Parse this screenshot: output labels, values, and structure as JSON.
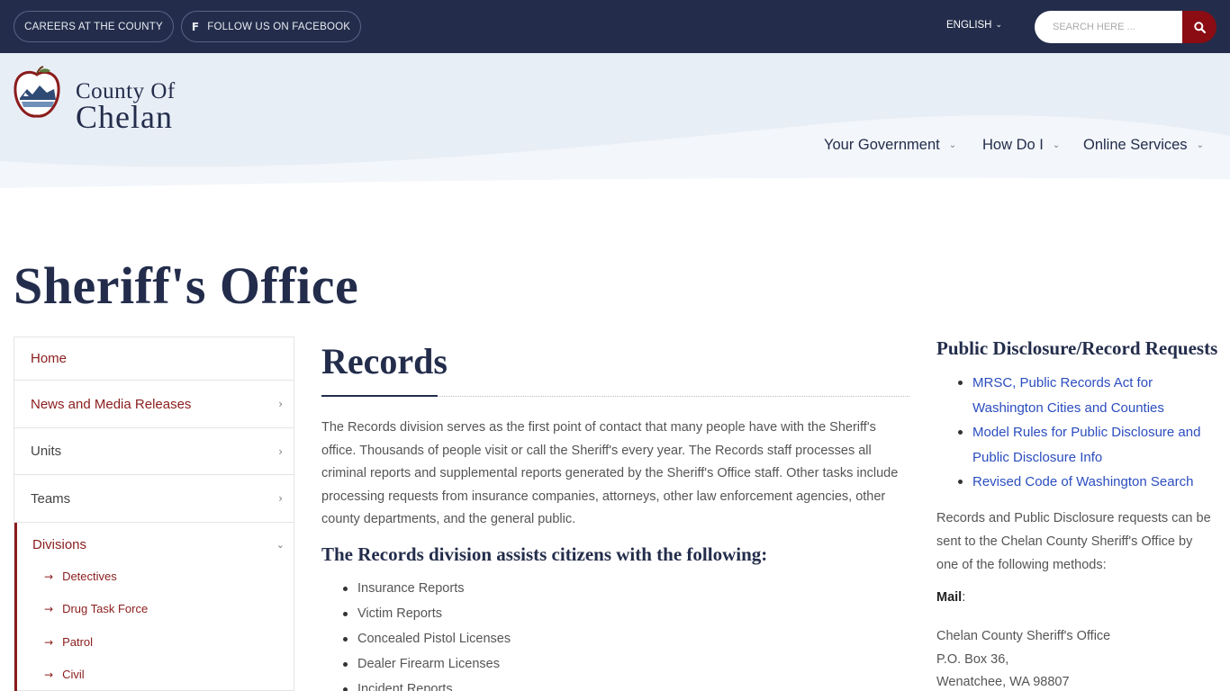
{
  "topbar": {
    "careers_label": "Careers at the County",
    "facebook_label": "Follow us on Facebook",
    "language_label": "English",
    "search_placeholder": "Search here ..."
  },
  "header": {
    "logo_line1": "County Of",
    "logo_line2": "Chelan",
    "nav": [
      {
        "label": "Your Government"
      },
      {
        "label": "How Do I"
      },
      {
        "label": "Online Services"
      }
    ]
  },
  "page_title": "Sheriff's Office",
  "sidebar": {
    "items": [
      {
        "label": "Home"
      },
      {
        "label": "News and Media Releases"
      },
      {
        "label": "Units"
      },
      {
        "label": "Teams"
      }
    ],
    "divisions": {
      "label": "Divisions",
      "sub_items": [
        {
          "label": "Detectives"
        },
        {
          "label": "Drug Task Force"
        },
        {
          "label": "Patrol"
        },
        {
          "label": "Civil"
        }
      ]
    }
  },
  "main": {
    "title": "Records",
    "intro": "The Records division serves as the first point of contact that many people have with the Sheriff's office. Thousands of people visit or call the Sheriff's every year. The Records staff processes all criminal reports and supplemental reports generated by the Sheriff's Office staff. Other tasks include processing requests from insurance companies, attorneys, other law enforcement agencies, other county departments, and the general public.",
    "subhead": "The Records division assists citizens with the following:",
    "list": [
      "Insurance Reports",
      "Victim Reports",
      "Concealed Pistol Licenses",
      "Dealer Firearm Licenses",
      "Incident Reports"
    ]
  },
  "right": {
    "title": "Public Disclosure/Record Requests",
    "links": [
      "MRSC, Public Records Act for Washington Cities and Counties",
      "Model Rules for Public Disclosure and Public Disclosure Info",
      "Revised Code of Washington Search"
    ],
    "text": "Records and Public Disclosure requests can be sent to the Chelan County Sheriff's Office by one of the following methods:",
    "mail_label": "Mail",
    "address": [
      "Chelan County Sheriff's Office",
      "P.O. Box 36,",
      "Wenatchee, WA 98807"
    ]
  },
  "colors": {
    "navy": "#232d4b",
    "accent_red": "#8b0c13",
    "link_blue": "#2b4dbf",
    "header_bg": "#e8eef6"
  },
  "icons": {
    "facebook": "facebook-icon",
    "search": "search-icon",
    "chevron": "chevron-down-icon",
    "arrow": "arrow-right-icon"
  }
}
